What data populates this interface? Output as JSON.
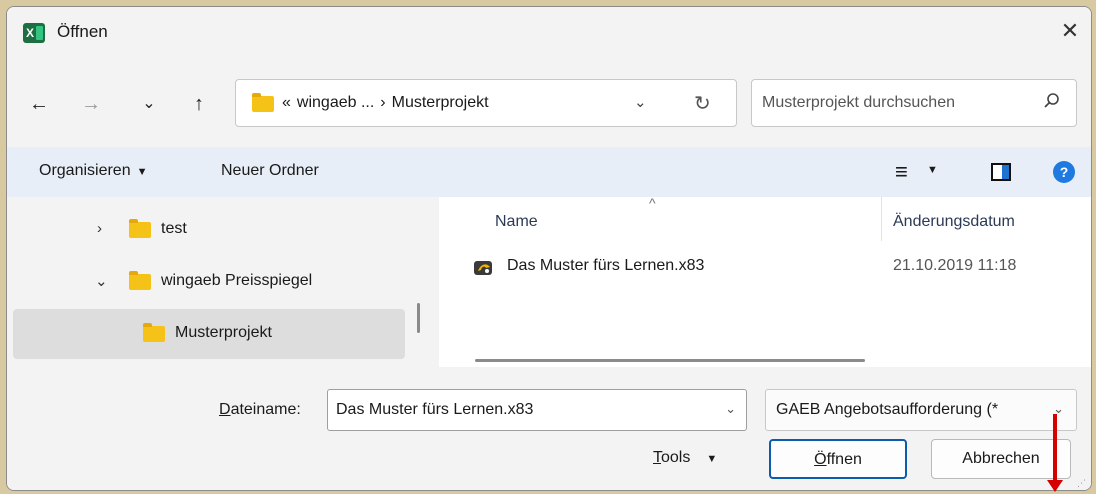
{
  "window": {
    "title": "Öffnen",
    "app_icon_letter": "X",
    "close_glyph": "✕"
  },
  "navigation": {
    "back": "←",
    "forward": "→",
    "recent": "⌄",
    "up": "↑"
  },
  "address_bar": {
    "overflow": "«",
    "parts": [
      "wingaeb ...",
      "›",
      "Musterprojekt"
    ],
    "dropdown": "⌄",
    "refresh": "↻"
  },
  "search": {
    "placeholder": "Musterprojekt durchsuchen"
  },
  "toolbar": {
    "organize_label": "Organisieren",
    "new_folder_label": "Neuer Ordner",
    "view_glyph": "≡",
    "caret": "▼",
    "help_glyph": "?"
  },
  "nav_tree": {
    "items": [
      {
        "label": "test",
        "chevron": "›",
        "state": "collapsed"
      },
      {
        "label": "wingaeb Preisspiegel",
        "chevron": "⌄",
        "state": "expanded"
      },
      {
        "label": "Musterprojekt",
        "chevron": "",
        "state": "selected"
      }
    ]
  },
  "file_list": {
    "columns": [
      "Name",
      "Änderungsdatum"
    ],
    "sort_indicator": "^",
    "files": [
      {
        "name": "Das Muster fürs Lernen.x83",
        "modified": "21.10.2019 11:18"
      }
    ]
  },
  "bottom": {
    "filename_label_accel": "D",
    "filename_label_rest": "ateiname:",
    "filename_value": "Das Muster fürs Lernen.x83",
    "filetype_value": "GAEB Angebotsaufforderung (*",
    "tools_accel": "T",
    "tools_rest": "ools",
    "open_accel": "Ö",
    "open_rest": "ffnen",
    "cancel_label": "Abbrechen",
    "dropdown": "⌄"
  },
  "colors": {
    "excel_green": "#1d6f42",
    "folder_yellow": "#f5c218",
    "toolbar_bg": "#e8eef7",
    "accent_blue": "#0b5cad",
    "annotation_red": "#d60000"
  }
}
